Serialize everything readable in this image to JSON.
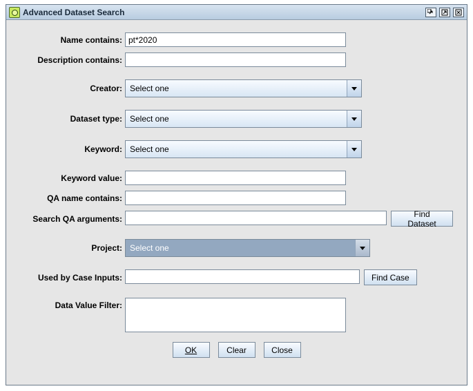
{
  "window": {
    "title": "Advanced Dataset Search"
  },
  "labels": {
    "name": "Name contains:",
    "description": "Description contains:",
    "creator": "Creator:",
    "datasetType": "Dataset type:",
    "keyword": "Keyword:",
    "keywordValue": "Keyword value:",
    "qaName": "QA name contains:",
    "qaArgs": "Search QA arguments:",
    "project": "Project:",
    "caseInputs": "Used by Case Inputs:",
    "dataValueFilter": "Data Value Filter:"
  },
  "values": {
    "name": "pt*2020",
    "description": "",
    "creator": "Select one",
    "datasetType": "Select one",
    "keyword": "Select one",
    "keywordValue": "",
    "qaName": "",
    "qaArgs": "",
    "project": "Select one",
    "caseInputs": "",
    "dataValueFilter": ""
  },
  "buttons": {
    "findDataset": "Find Dataset",
    "findCase": "Find Case",
    "ok": "OK",
    "clear": "Clear",
    "close": "Close"
  }
}
